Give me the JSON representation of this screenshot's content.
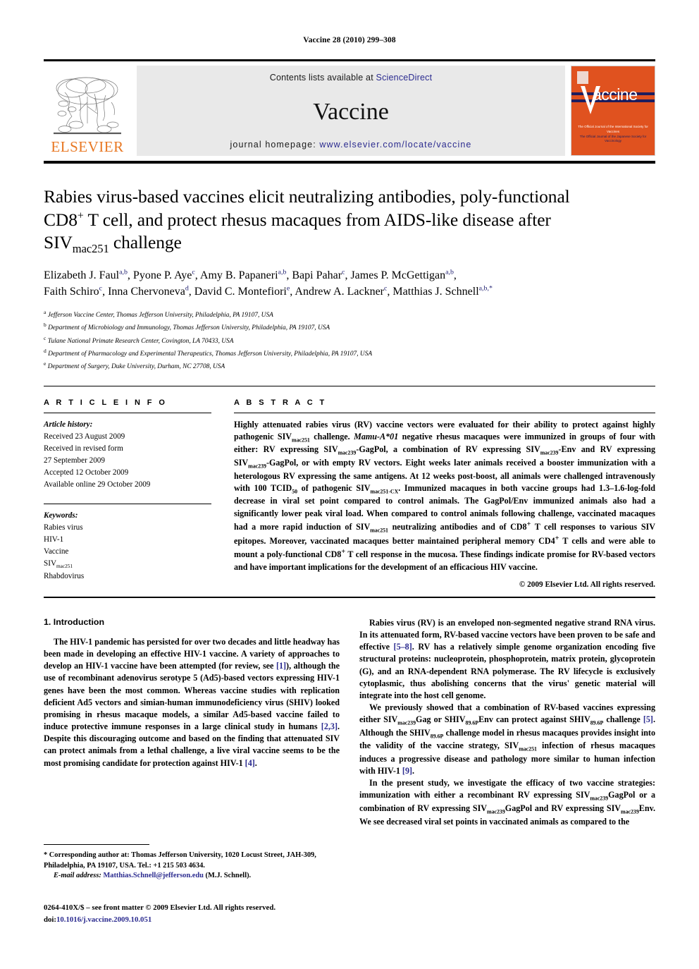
{
  "running_head": "Vaccine 28 (2010) 299–308",
  "masthead": {
    "publisher_name": "ELSEVIER",
    "contents_prefix": "Contents lists available at ",
    "contents_link": "ScienceDirect",
    "journal_name": "Vaccine",
    "homepage_prefix": "journal homepage: ",
    "homepage_url": "www.elsevier.com/locate/vaccine",
    "cover_word": "accine",
    "cover_footer_line1": "The Official Journal of the International Society for Vaccines",
    "cover_footer_line2": "The Official Journal of the Japanese Society for Vaccinology",
    "accent_orange": "#E87722",
    "cover_orange": "#e0521f",
    "link_blue": "#2b2b8f"
  },
  "title": {
    "line1": "Rabies virus-based vaccines elicit neutralizing antibodies, poly-functional",
    "line2_a": "CD8",
    "line2_sup": "+",
    "line2_b": " T cell, and protect rhesus macaques from AIDS-like disease after",
    "line3_a": "SIV",
    "line3_sub": "mac251",
    "line3_b": " challenge"
  },
  "authors": [
    {
      "name": "Elizabeth J. Faul",
      "aff": "a,b",
      "sep": ", "
    },
    {
      "name": "Pyone P. Aye",
      "aff": "c",
      "sep": ", "
    },
    {
      "name": "Amy B. Papaneri",
      "aff": "a,b",
      "sep": ", "
    },
    {
      "name": "Bapi Pahar",
      "aff": "c",
      "sep": ", "
    },
    {
      "name": "James P. McGettigan",
      "aff": "a,b",
      "sep": ", "
    },
    {
      "name": "Faith Schiro",
      "aff": "c",
      "sep": ", "
    },
    {
      "name": "Inna Chervoneva",
      "aff": "d",
      "sep": ", "
    },
    {
      "name": "David C. Montefiori",
      "aff": "e",
      "sep": ", "
    },
    {
      "name": "Andrew A. Lackner",
      "aff": "c",
      "sep": ", "
    },
    {
      "name": "Matthias J. Schnell",
      "aff": "a,b,*",
      "sep": ""
    }
  ],
  "affiliations": [
    {
      "mark": "a",
      "text": "Jefferson Vaccine Center, Thomas Jefferson University, Philadelphia, PA 19107, USA"
    },
    {
      "mark": "b",
      "text": "Department of Microbiology and Immunology, Thomas Jefferson University, Philadelphia, PA 19107, USA"
    },
    {
      "mark": "c",
      "text": "Tulane National Primate Research Center, Covington, LA 70433, USA"
    },
    {
      "mark": "d",
      "text": "Department of Pharmacology and Experimental Therapeutics, Thomas Jefferson University, Philadelphia, PA 19107, USA"
    },
    {
      "mark": "e",
      "text": "Department of Surgery, Duke University, Durham, NC 27708, USA"
    }
  ],
  "article_info": {
    "heading": "A R T I C L E   I N F O",
    "history_label": "Article history:",
    "history": [
      "Received 23 August 2009",
      "Received in revised form",
      "27 September 2009",
      "Accepted 12 October 2009",
      "Available online 29 October 2009"
    ],
    "keywords_label": "Keywords:",
    "keywords": [
      "Rabies virus",
      "HIV-1",
      "Vaccine",
      "SIVmac251",
      "Rhabdovirus"
    ]
  },
  "abstract": {
    "heading": "A B S T R A C T",
    "copyright": "© 2009 Elsevier Ltd. All rights reserved."
  },
  "introduction": {
    "heading": "1.  Introduction"
  },
  "footnote": {
    "corresponding": "* Corresponding author at: Thomas Jefferson University, 1020 Locust Street, JAH-309, Philadelphia, PA 19107, USA. Tel.: +1 215 503 4634.",
    "email_label": "E-mail address:",
    "email": "Matthias.Schnell@jefferson.edu",
    "email_suffix": " (M.J. Schnell)."
  },
  "issn": {
    "line1": "0264-410X/$ – see front matter © 2009 Elsevier Ltd. All rights reserved.",
    "doi_label": "doi:",
    "doi": "10.1016/j.vaccine.2009.10.051"
  }
}
